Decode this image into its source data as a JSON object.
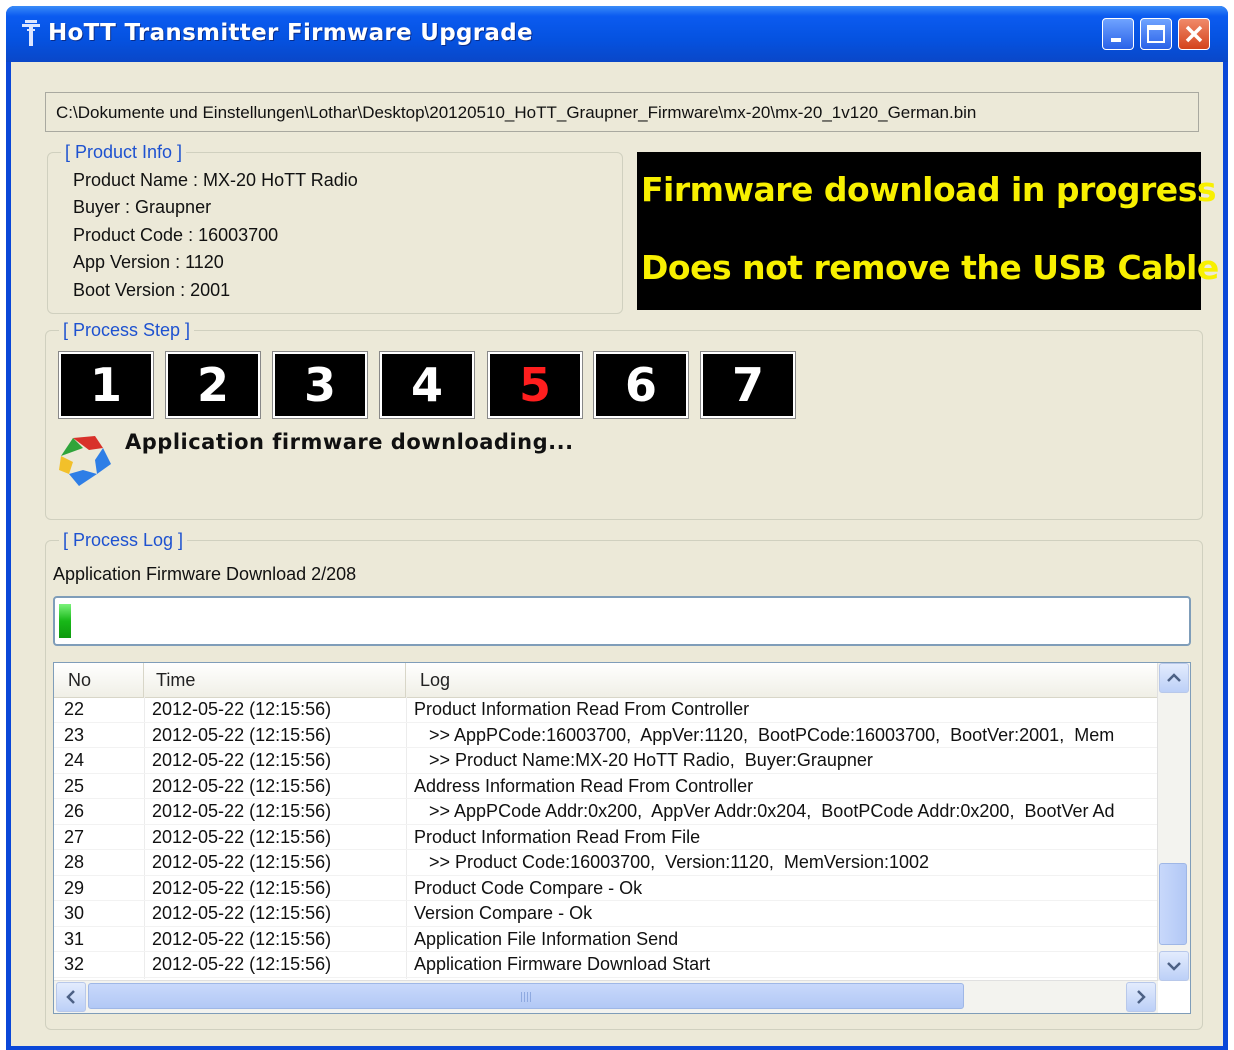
{
  "window": {
    "title": "HoTT Transmitter Firmware Upgrade",
    "file_path": "C:\\Dokumente und Einstellungen\\Lothar\\Desktop\\20120510_HoTT_Graupner_Firmware\\mx-20\\mx-20_1v120_German.bin"
  },
  "product_info": {
    "legend": "[ Product Info ]",
    "lines": [
      "Product Name : MX-20 HoTT Radio",
      "Buyer : Graupner",
      "Product Code : 16003700",
      "App Version : 1120",
      "Boot Version : 2001"
    ]
  },
  "banner": {
    "line1": "Firmware download in progress",
    "line2": "Does not remove the USB Cable",
    "text_color": "#f8f000",
    "background": "#000000"
  },
  "process_step": {
    "legend": "[ Process Step ]",
    "steps": [
      "1",
      "2",
      "3",
      "4",
      "5",
      "6",
      "7"
    ],
    "active_step": "5",
    "status": "Application firmware downloading..."
  },
  "process_log": {
    "legend": "[ Process Log ]",
    "download_label": "Application Firmware Download   2/208",
    "progress_fraction": 0.0096,
    "columns": [
      "No",
      "Time",
      "Log"
    ],
    "rows": [
      [
        "22",
        "2012-05-22 (12:15:56)",
        "Product Information Read From Controller"
      ],
      [
        "23",
        "2012-05-22 (12:15:56)",
        "   >> AppPCode:16003700,  AppVer:1120,  BootPCode:16003700,  BootVer:2001,  Mem"
      ],
      [
        "24",
        "2012-05-22 (12:15:56)",
        "   >> Product Name:MX-20 HoTT Radio,  Buyer:Graupner"
      ],
      [
        "25",
        "2012-05-22 (12:15:56)",
        "Address Information Read From Controller"
      ],
      [
        "26",
        "2012-05-22 (12:15:56)",
        "   >> AppPCode Addr:0x200,  AppVer Addr:0x204,  BootPCode Addr:0x200,  BootVer Ad"
      ],
      [
        "27",
        "2012-05-22 (12:15:56)",
        "Product Information Read From File"
      ],
      [
        "28",
        "2012-05-22 (12:15:56)",
        "   >> Product Code:16003700,  Version:1120,  MemVersion:1002"
      ],
      [
        "29",
        "2012-05-22 (12:15:56)",
        "Product Code Compare - Ok"
      ],
      [
        "30",
        "2012-05-22 (12:15:56)",
        "Version Compare - Ok"
      ],
      [
        "31",
        "2012-05-22 (12:15:56)",
        "Application File Information Send"
      ],
      [
        "32",
        "2012-05-22 (12:15:56)",
        "Application Firmware Download Start"
      ]
    ]
  },
  "icons": [
    "antenna-icon",
    "minimize-icon",
    "maximize-icon",
    "close-icon",
    "refresh-arrows-icon",
    "scroll-up-icon",
    "scroll-down-icon",
    "scroll-left-icon",
    "scroll-right-icon"
  ],
  "colors": {
    "title_bar": "#0552e0",
    "legend_text": "#1e52d0",
    "active_step": "#ff1e1e",
    "progress_fill": "#18b818"
  }
}
